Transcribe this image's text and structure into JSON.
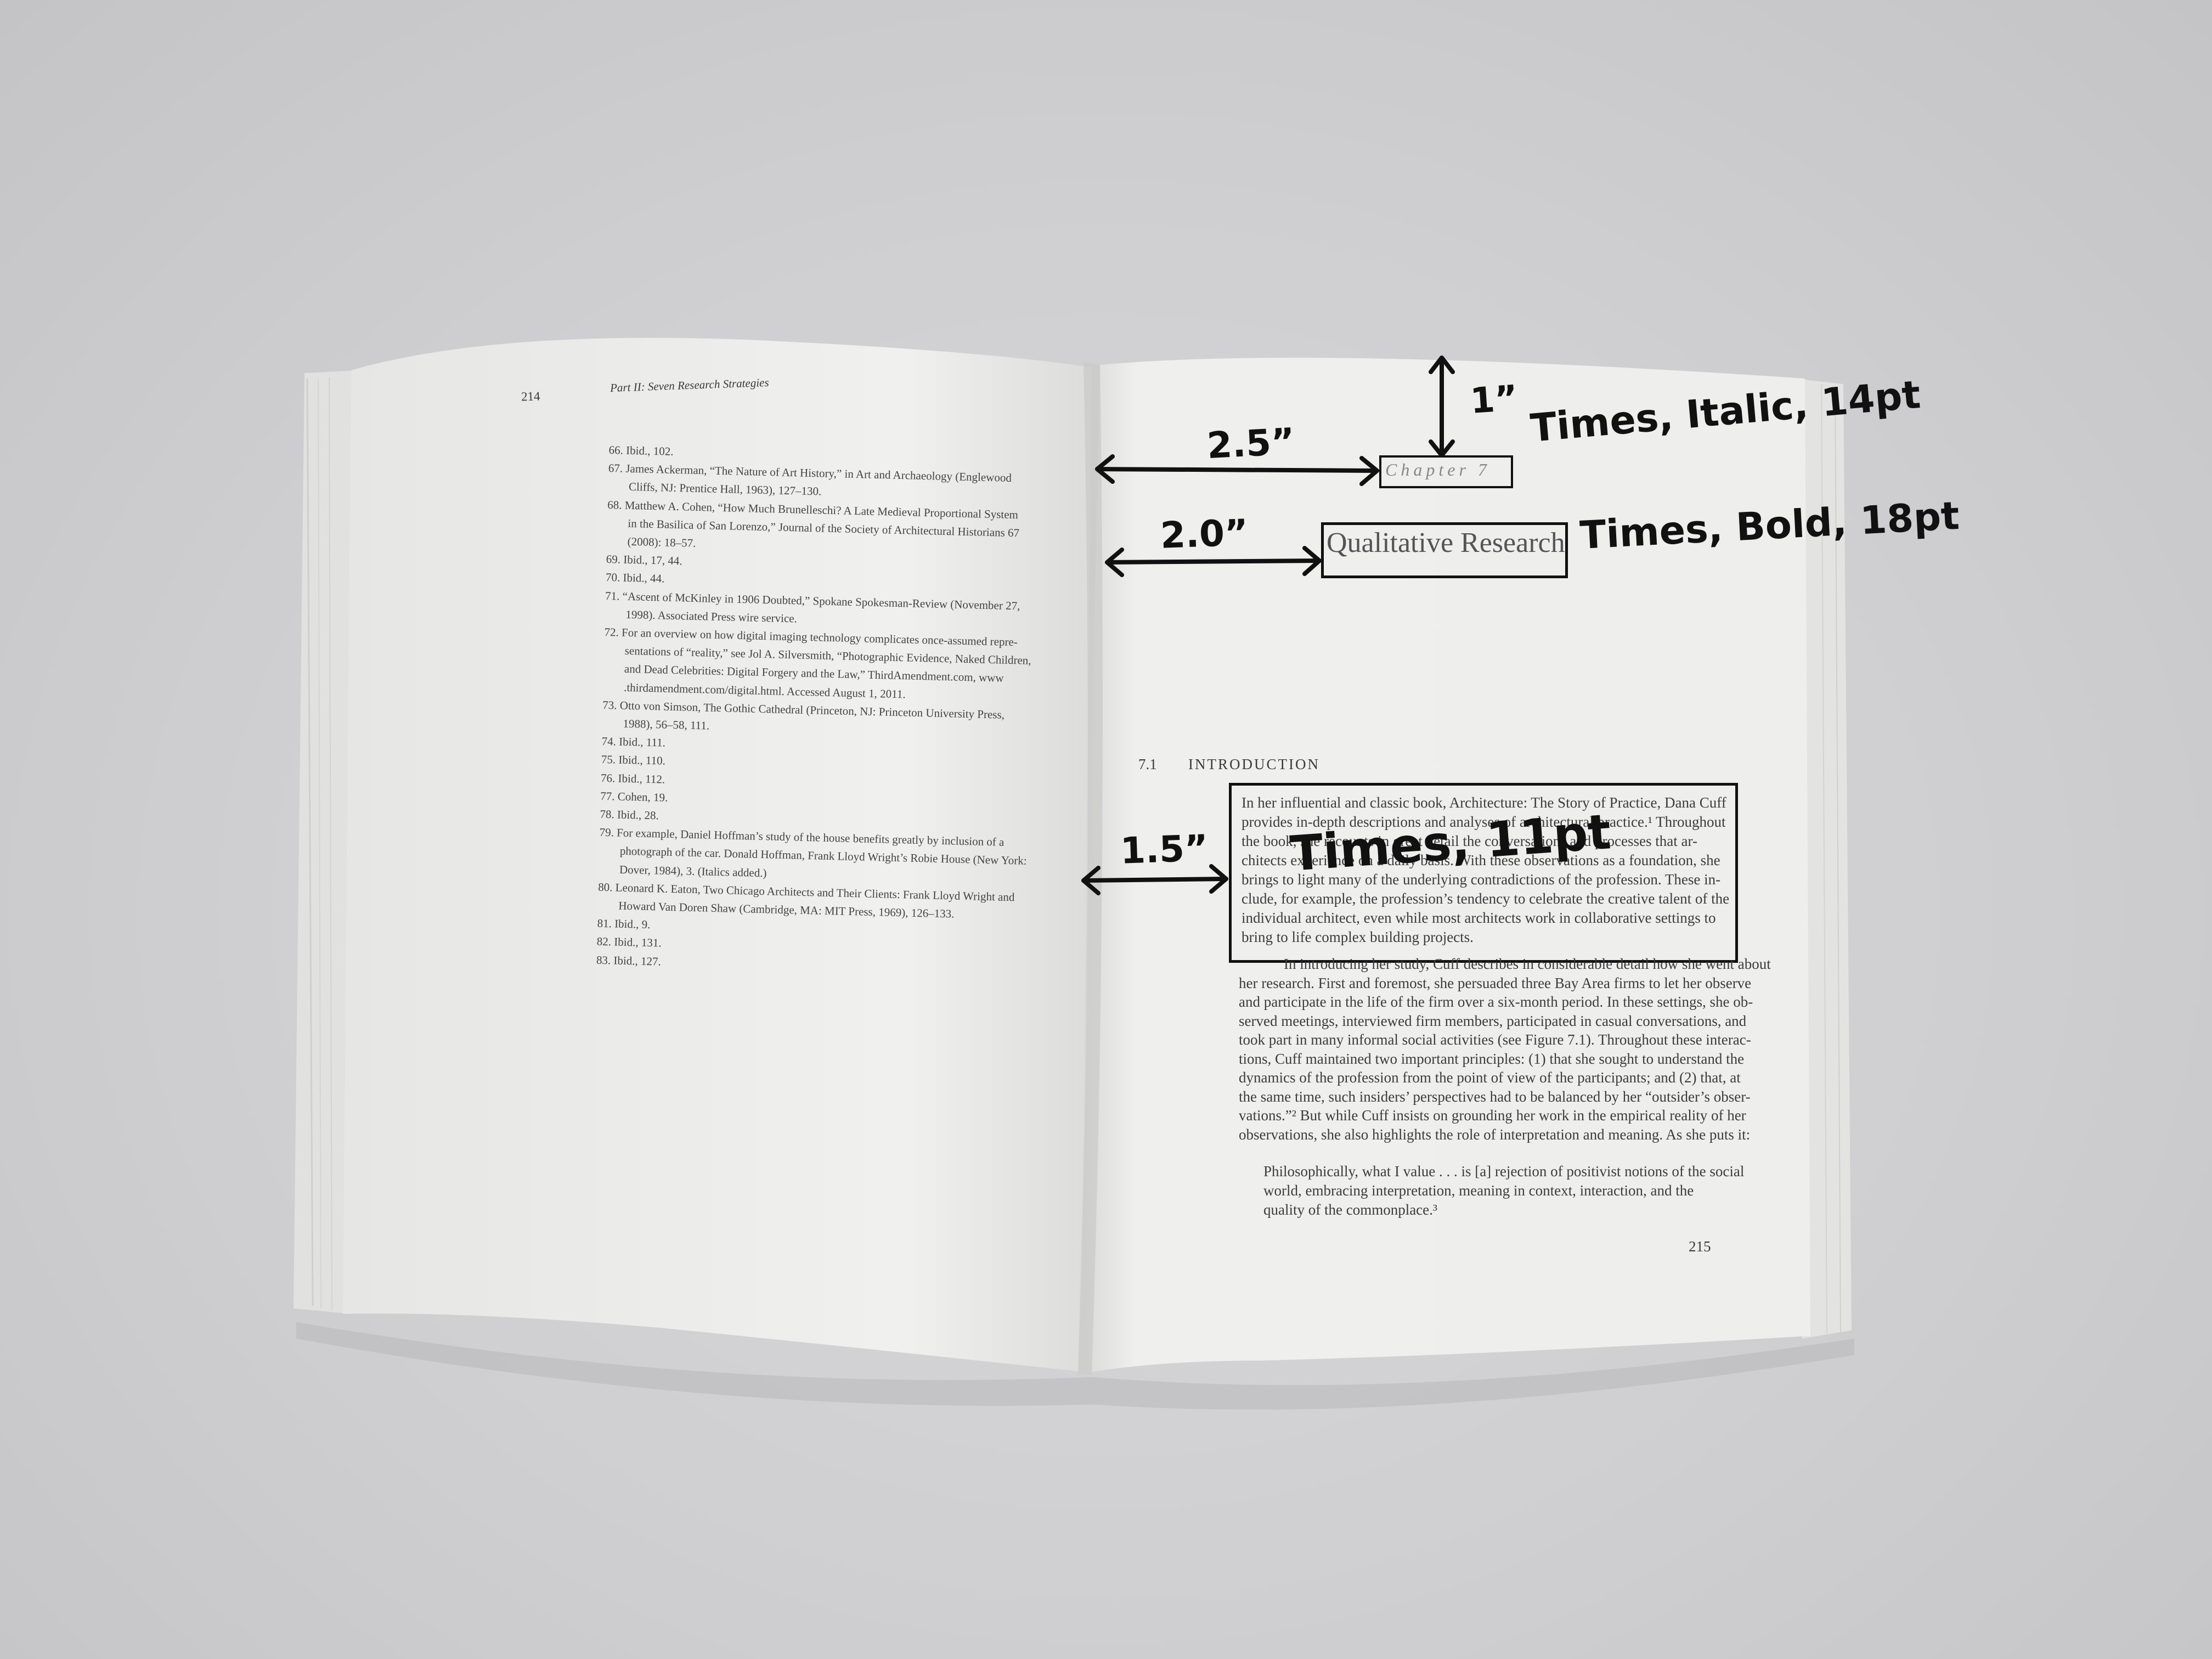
{
  "left_page": {
    "page_number": "214",
    "running_head": "Part II: Seven Research Strategies",
    "notes": [
      "66.  Ibid., 102.",
      "67.  James Ackerman, “The Nature of Art History,” in Art and Archaeology (Englewood",
      "Cliffs, NJ: Prentice Hall, 1963), 127–130.",
      "68.  Matthew A. Cohen, “How Much Brunelleschi? A Late Medieval Proportional System",
      "in the Basilica of San Lorenzo,” Journal of the Society of Architectural Historians 67",
      "(2008): 18–57.",
      "69.  Ibid., 17, 44.",
      "70.  Ibid., 44.",
      "71.  “Ascent of McKinley in 1906 Doubted,” Spokane Spokesman-Review (November 27,",
      "1998). Associated Press wire service.",
      "72.  For an overview on how digital imaging technology complicates once-assumed repre-",
      "sentations of “reality,” see Jol A. Silversmith, “Photographic Evidence, Naked Children,",
      "and Dead Celebrities: Digital Forgery and the Law,” ThirdAmendment.com, www",
      ".thirdamendment.com/digital.html. Accessed August 1, 2011.",
      "73.  Otto von Simson, The Gothic Cathedral (Princeton, NJ: Princeton University Press,",
      "1988), 56–58, 111.",
      "74.  Ibid., 111.",
      "75.  Ibid., 110.",
      "76.  Ibid., 112.",
      "77.  Cohen, 19.",
      "78.  Ibid., 28.",
      "79.  For example, Daniel Hoffman’s study of the house benefits greatly by inclusion of a",
      "photograph of the car. Donald Hoffman, Frank Lloyd Wright’s Robie House (New York:",
      "Dover, 1984), 3. (Italics added.)",
      "80.  Leonard K. Eaton, Two Chicago Architects and Their Clients: Frank Lloyd Wright and",
      "Howard Van Doren Shaw (Cambridge, MA: MIT Press, 1969), 126–133.",
      "81.  Ibid., 9.",
      "82.  Ibid., 131.",
      "83.  Ibid., 127."
    ]
  },
  "right_page": {
    "chapter_label": "Chapter 7",
    "chapter_title": "Qualitative Research",
    "section_number": "7.1",
    "section_title": "INTRODUCTION",
    "boxed_paragraph": [
      "In her influential and classic book, Architecture: The Story of Practice, Dana Cuff",
      "provides in-depth descriptions and analyses of architectural practice.¹ Throughout",
      "the book, she recounts in great detail the conversations and processes that ar-",
      "chitects experience on a daily basis. With these observations as a foundation, she",
      "brings to light many of the underlying contradictions of the profession. These in-",
      "clude, for example, the profession’s tendency to celebrate the creative talent of the",
      "individual architect, even while most architects work in collaborative settings to",
      "bring to life complex building projects."
    ],
    "body_paragraph": [
      "In introducing her study, Cuff describes in considerable detail how she went about",
      "her research. First and foremost, she persuaded three Bay Area firms to let her observe",
      "and participate in the life of the firm over a six-month period. In these settings, she ob-",
      "served meetings, interviewed firm members, participated in casual conversations, and",
      "took part in many informal social activities (see Figure 7.1). Throughout these interac-",
      "tions, Cuff maintained two important principles: (1) that she sought to understand the",
      "dynamics of the profession from the point of view of the participants; and (2) that, at",
      "the same time, such insiders’ perspectives had to be balanced by her “outsider’s obser-",
      "vations.”² But while Cuff insists on grounding her work in the empirical reality of her",
      "observations, she also highlights the role of interpretation and meaning. As she puts it:"
    ],
    "quote": [
      "Philosophically, what I value . . . is [a] rejection of positivist notions of the social",
      "world, embracing interpretation, meaning in context, interaction, and the",
      "quality of the commonplace.³"
    ],
    "page_number": "215"
  },
  "annotations": {
    "top_margin": "1”",
    "chapter_indent": "2.5”",
    "chapter_spec": "Times, Italic, 14pt",
    "title_indent": "2.0”",
    "title_spec": "Times, Bold, 18pt",
    "body_indent": "1.5”",
    "body_spec": "Times, 11pt"
  },
  "colors": {
    "background": "#cfcfd1",
    "paper": "#efefed",
    "ink": "#111111",
    "print": "#3a3a3a"
  }
}
